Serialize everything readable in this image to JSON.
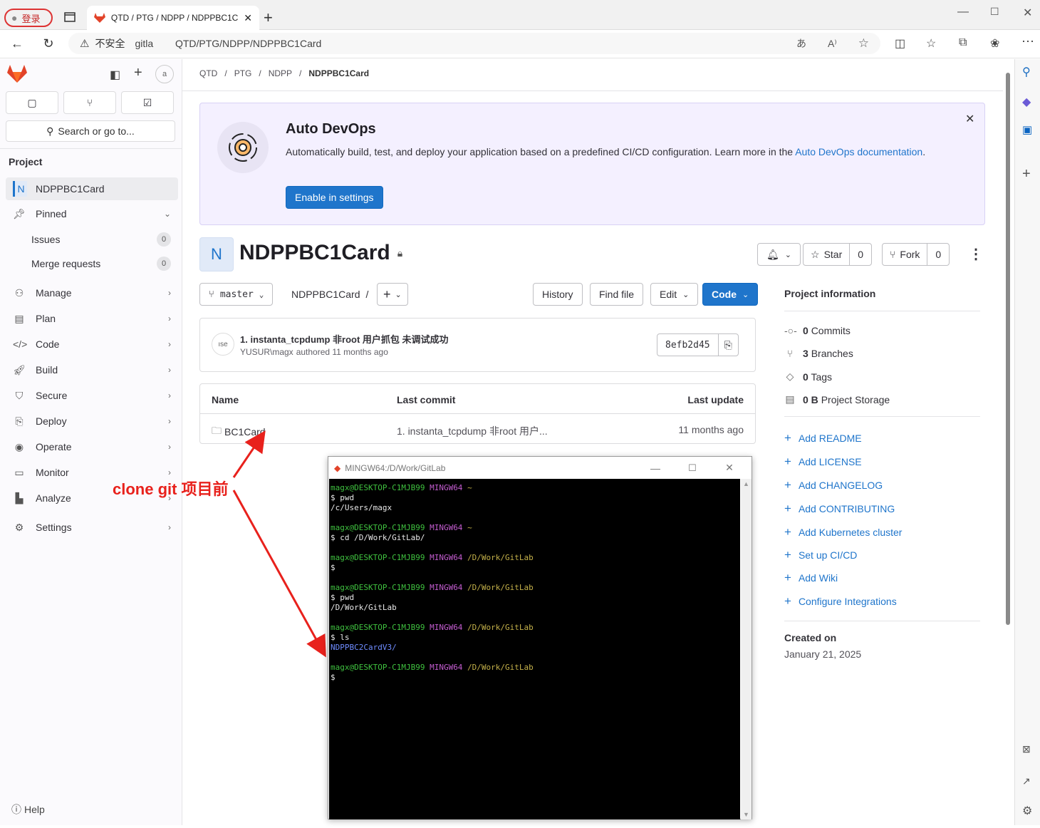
{
  "browser": {
    "profile_label": "登录",
    "tab_title": "QTD / PTG / NDPP / NDPPBC1Ca",
    "security": "不安全",
    "url": "gitla     QTD/PTG/NDPP/NDPPBC1Card",
    "read_aloud": "A⁾"
  },
  "sidebar": {
    "search_placeholder": "Search or go to...",
    "section_title": "Project",
    "project_initial": "N",
    "project_name": "NDPPBC1Card",
    "pinned": "Pinned",
    "pinned_items": [
      {
        "label": "Issues",
        "count": "0"
      },
      {
        "label": "Merge requests",
        "count": "0"
      }
    ],
    "items": [
      {
        "label": "Manage",
        "icon": "manage-icon"
      },
      {
        "label": "Plan",
        "icon": "plan-icon"
      },
      {
        "label": "Code",
        "icon": "code-icon"
      },
      {
        "label": "Build",
        "icon": "build-icon"
      },
      {
        "label": "Secure",
        "icon": "shield-icon"
      },
      {
        "label": "Deploy",
        "icon": "deploy-icon"
      },
      {
        "label": "Operate",
        "icon": "operate-icon"
      },
      {
        "label": "Monitor",
        "icon": "monitor-icon"
      },
      {
        "label": "Analyze",
        "icon": "analyze-icon"
      },
      {
        "label": "Settings",
        "icon": "gear-icon"
      }
    ],
    "help": "Help"
  },
  "breadcrumb": [
    "QTD",
    "PTG",
    "NDPP",
    "NDPPBC1Card"
  ],
  "devops": {
    "title": "Auto DevOps",
    "text": "Automatically build, test, and deploy your application based on a predefined CI/CD configuration. Learn more in the ",
    "link": "Auto DevOps",
    "link2": "documentation",
    "period": ".",
    "button": "Enable in settings"
  },
  "project": {
    "initial": "N",
    "name": "NDPPBC1Card",
    "star": "Star",
    "star_count": "0",
    "fork": "Fork",
    "fork_count": "0",
    "branch": "master",
    "path": "NDPPBC1Card",
    "history": "History",
    "find_file": "Find file",
    "edit": "Edit",
    "code": "Code"
  },
  "commit": {
    "message": "1. instanta_tcpdump 非root 用户抓包 未调试成功",
    "author": "YUSUR\\magx",
    "meta": "authored 11 months ago",
    "sha": "8efb2d45"
  },
  "files": {
    "headers": [
      "Name",
      "Last commit",
      "Last update"
    ],
    "rows": [
      {
        "name": "BC1Card",
        "commit": "1. instanta_tcpdump 非root 用户...",
        "updated": "11 months ago"
      }
    ]
  },
  "info": {
    "title": "Project information",
    "stats": [
      {
        "bold": "0",
        "label": "Commits"
      },
      {
        "bold": "3",
        "label": "Branches"
      },
      {
        "bold": "0",
        "label": "Tags"
      },
      {
        "bold": "0 B",
        "label": "Project Storage"
      }
    ],
    "links": [
      "Add README",
      "Add LICENSE",
      "Add CHANGELOG",
      "Add CONTRIBUTING",
      "Add Kubernetes cluster",
      "Set up CI/CD",
      "Add Wiki",
      "Configure Integrations"
    ],
    "created_label": "Created on",
    "created_date": "January 21, 2025"
  },
  "annotation": "clone git 项目前",
  "terminal": {
    "title": "MINGW64:/D/Work/GitLab",
    "user": "magx@DESKTOP-C1MJB99",
    "shell": "MINGW64",
    "blocks": [
      {
        "dir": "~",
        "lines": [
          "$ pwd",
          "/c/Users/magx"
        ]
      },
      {
        "dir": "~",
        "lines": [
          "$ cd /D/Work/GitLab/"
        ]
      },
      {
        "dir": "/D/Work/GitLab",
        "lines": [
          "$"
        ]
      },
      {
        "dir": "/D/Work/GitLab",
        "lines": [
          "$ pwd",
          "/D/Work/GitLab"
        ]
      },
      {
        "dir": "/D/Work/GitLab",
        "lines": [
          "$ ls"
        ],
        "listing": "NDPPBC2CardV3/"
      },
      {
        "dir": "/D/Work/GitLab",
        "lines": [
          "$ "
        ]
      }
    ]
  },
  "colors": {
    "accent": "#1f75cb",
    "annotation": "#e8211c",
    "gitlab_orange": "#e24329"
  }
}
